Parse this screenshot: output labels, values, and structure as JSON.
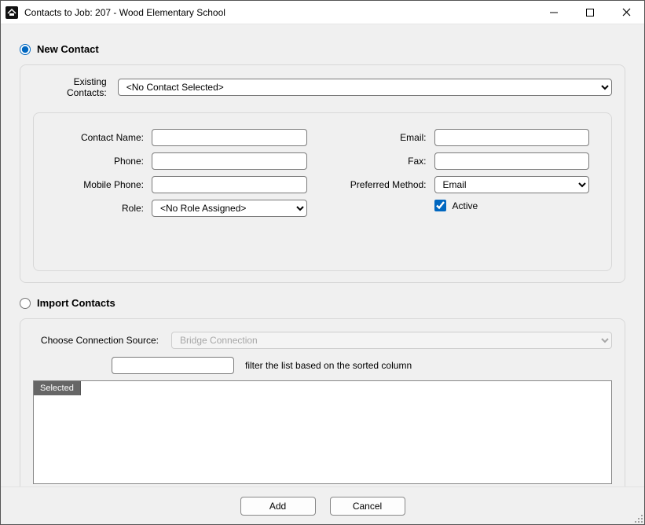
{
  "window": {
    "title": "Contacts to Job: 207 - Wood Elementary School"
  },
  "modes": {
    "new_contact_label": "New Contact",
    "import_contacts_label": "Import Contacts",
    "selected": "new"
  },
  "new_contact": {
    "existing_label": "Existing Contacts:",
    "existing_selected": "<No Contact Selected>",
    "fields": {
      "contact_name": {
        "label": "Contact Name:",
        "value": ""
      },
      "phone": {
        "label": "Phone:",
        "value": ""
      },
      "mobile_phone": {
        "label": "Mobile Phone:",
        "value": ""
      },
      "role": {
        "label": "Role:",
        "selected": "<No Role Assigned>"
      },
      "email": {
        "label": "Email:",
        "value": ""
      },
      "fax": {
        "label": "Fax:",
        "value": ""
      },
      "preferred": {
        "label": "Preferred Method:",
        "selected": "Email"
      },
      "active": {
        "label": "Active",
        "checked": true
      }
    }
  },
  "import": {
    "source_label": "Choose Connection Source:",
    "source_selected": "Bridge Connection",
    "filter_value": "",
    "filter_hint": "filter the list based on the sorted column",
    "grid": {
      "columns": [
        "Selected"
      ]
    }
  },
  "footer": {
    "add_label": "Add",
    "cancel_label": "Cancel"
  }
}
